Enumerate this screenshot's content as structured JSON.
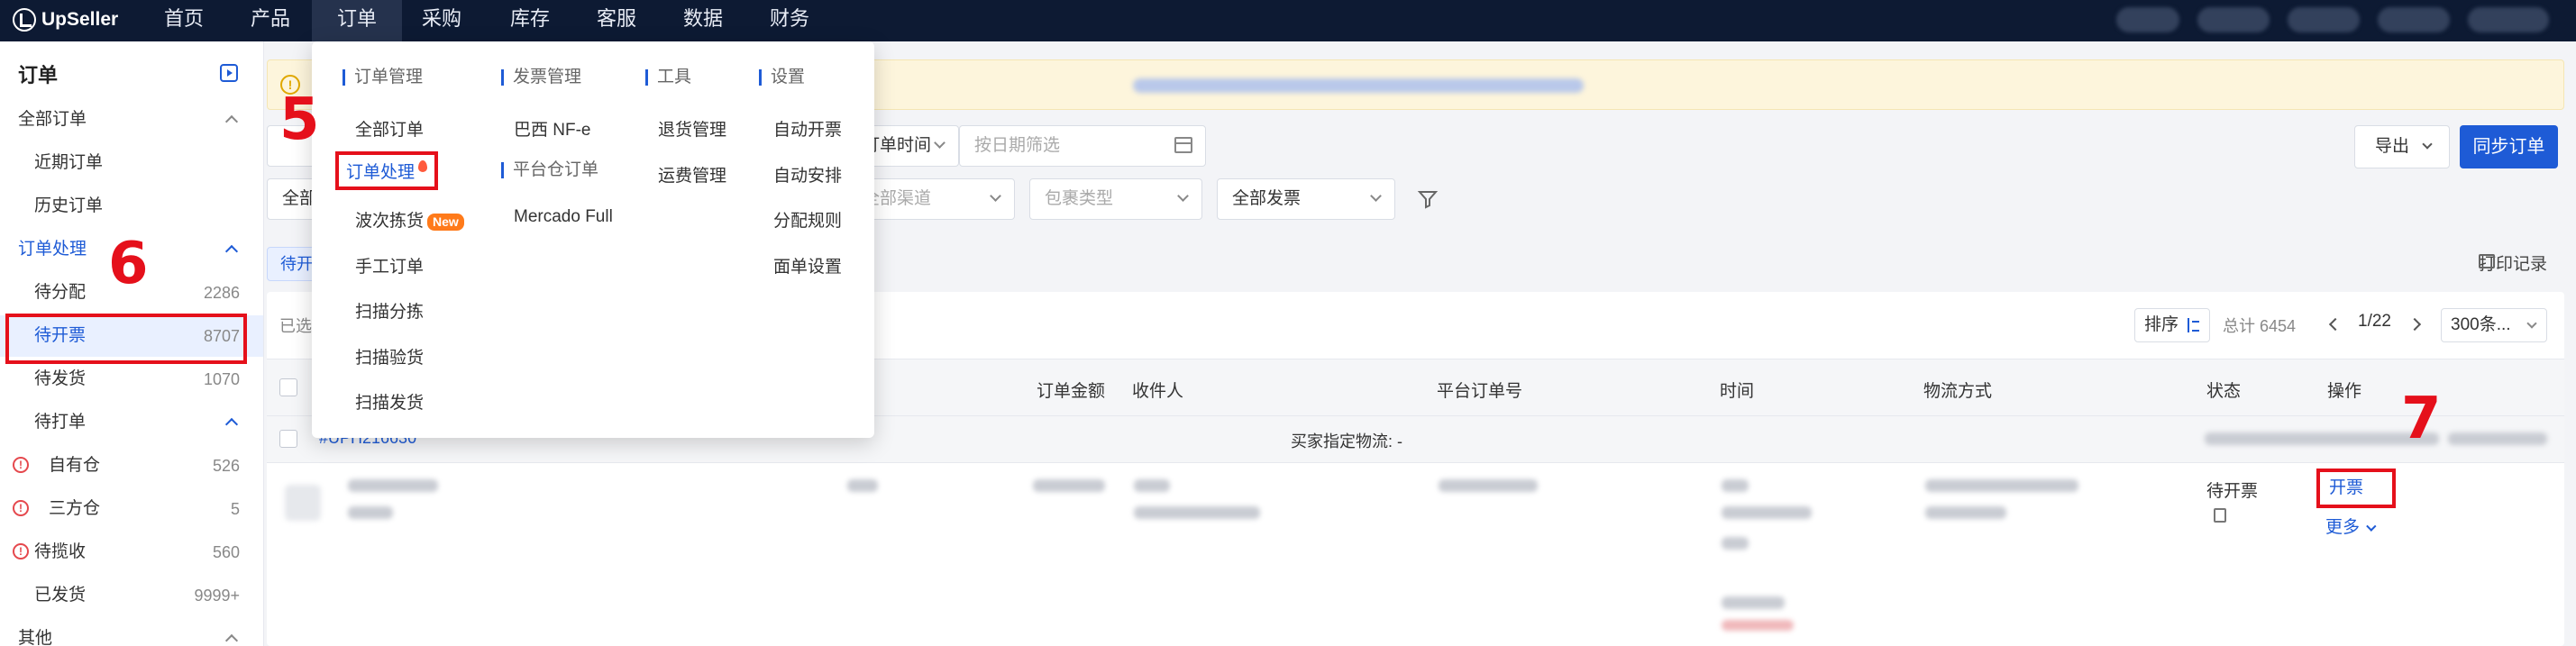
{
  "app": {
    "name": "UpSeller"
  },
  "topnav": {
    "items": [
      "首页",
      "产品",
      "订单",
      "采购",
      "库存",
      "客服",
      "数据",
      "财务"
    ],
    "active_index": 2
  },
  "sidebar": {
    "title": "订单",
    "sections": {
      "all_orders": "全部订单",
      "recent": "近期订单",
      "history": "历史订单",
      "processing": "订单处理",
      "to_assign": {
        "label": "待分配",
        "count": "2286"
      },
      "to_invoice": {
        "label": "待开票",
        "count": "8707"
      },
      "to_ship": {
        "label": "待发货",
        "count": "1070"
      },
      "to_print": "待打单",
      "own_wh": {
        "label": "自有仓",
        "count": "526"
      },
      "third_wh": {
        "label": "三方仓",
        "count": "5"
      },
      "to_pickup": {
        "label": "待揽收",
        "count": "560"
      },
      "shipped": {
        "label": "已发货",
        "count": "9999+"
      },
      "other": "其他"
    }
  },
  "filters": {
    "time_field": "订单时间",
    "date_placeholder": "按日期筛选",
    "all_prefix": "全部",
    "channel_placeholder": "全部渠道",
    "package_type_placeholder": "包裹类型",
    "invoice_filter": "全部发票",
    "export": "导出",
    "sync": "同步订单",
    "tab_chip": "待开",
    "print_log": "打印记录"
  },
  "table": {
    "selected_prefix": "已选",
    "sort": "排序",
    "total": "总计 6454",
    "page": "1/22",
    "per_page": "300条...",
    "headers": [
      "订单金额",
      "收件人",
      "平台订单号",
      "时间",
      "物流方式",
      "状态",
      "操作"
    ],
    "group": {
      "order_no": "#UPH216630",
      "buyer_logistics": "买家指定物流: -"
    },
    "row": {
      "status": "待开票",
      "invoice_action": "开票",
      "more": "更多"
    }
  },
  "menu": {
    "columns": [
      {
        "head": "订单管理",
        "items": [
          "全部订单",
          "订单处理",
          "波次拣货",
          "手工订单",
          "扫描分拣",
          "扫描验货",
          "扫描发货"
        ]
      },
      {
        "head": "发票管理",
        "items": [
          "巴西 NF-e"
        ],
        "head2": "平台仓订单",
        "items2": [
          "Mercado Full"
        ]
      },
      {
        "head": "工具",
        "items": [
          "退货管理",
          "运费管理"
        ]
      },
      {
        "head": "设置",
        "items": [
          "自动开票",
          "自动安排",
          "分配规则",
          "面单设置"
        ]
      }
    ],
    "new_badge": "New"
  },
  "annotations": [
    "5",
    "6",
    "7"
  ],
  "colors": {
    "primary": "#1e5bd6",
    "topbar": "#0d1a33",
    "annotation": "#e5101b"
  }
}
